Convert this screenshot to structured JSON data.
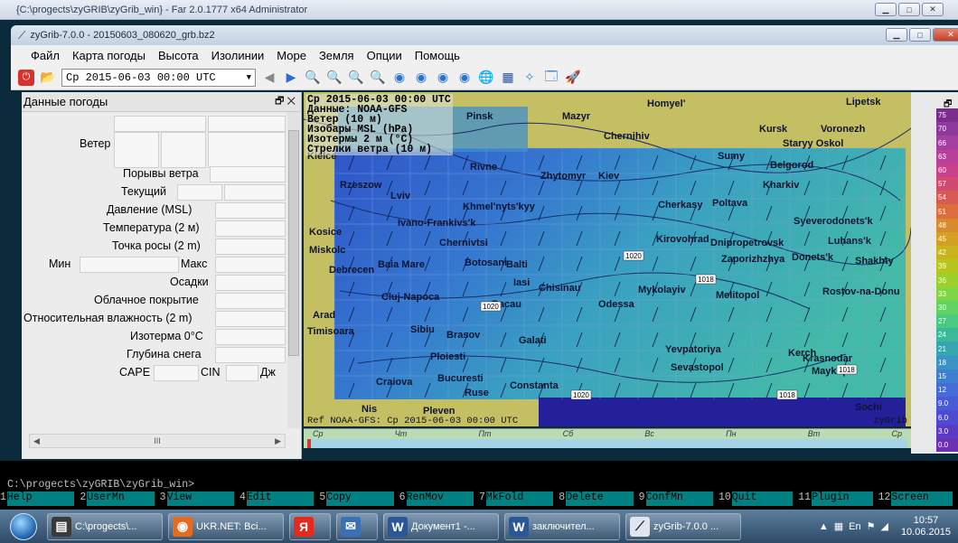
{
  "far_window": {
    "title": "{C:\\progects\\zyGRIB\\zyGrib_win} - Far 2.0.1777 x64 Administrator"
  },
  "app_window": {
    "title": "zyGrib-7.0.0 - 20150603_080620_grb.bz2"
  },
  "menu": [
    "Файл",
    "Карта погоды",
    "Высота",
    "Изолинии",
    "Море",
    "Земля",
    "Опции",
    "Помощь"
  ],
  "toolbar": {
    "date_value": "Ср 2015-06-03 00:00 UTC"
  },
  "panel": {
    "title": "Данные погоды",
    "labels": {
      "wind": "Ветер",
      "gusts": "Порывы ветра",
      "current": "Текущий",
      "pressure": "Давление (MSL)",
      "temperature": "Температура (2 м)",
      "dewpoint": "Точка росы (2 m)",
      "min": "Мин",
      "max": "Макс",
      "precip": "Осадки",
      "cloud": "Облачное покрытие",
      "humidity": "Относительная влажность (2 m)",
      "isotherm": "Изотерма 0°C",
      "snow": "Глубина снега",
      "cape": "CAPE",
      "cin": "CIN",
      "dj": "Дж"
    },
    "hscroll_mark": "III"
  },
  "map": {
    "info_lines": [
      "Ср 2015-06-03 00:00 UTC",
      "Данные: NOAA-GFS",
      "Ветер (10 м)",
      "Изобары MSL (hPa)",
      "Изотермы 2 м (°C)",
      "Стрелки ветра (10 м)"
    ],
    "footer_left": "Ref NOAA-GFS: Ср 2015-06-03 00:00 UTC",
    "footer_right": "zyGrib",
    "cities": [
      "Lipetsk",
      "Homyel'",
      "Pinsk",
      "Mazyr",
      "Kursk",
      "Voronezh",
      "Chernihiv",
      "Staryy Oskol",
      "Sumy",
      "Kielce",
      "Rivne",
      "Zhytomyr",
      "Kiev",
      "Belgorod",
      "Kharkiv",
      "Rzeszow",
      "Lviv",
      "Khmel'nyts'kyy",
      "Cherkasy",
      "Poltava",
      "Kosice",
      "Ivano-Frankivs'k",
      "Syeverodonets'k",
      "Chernivtsi",
      "Kirovohrad",
      "Dnipropetrovsk",
      "Luhans'k",
      "Miskolc",
      "Debrecen",
      "Baia Mare",
      "Botosani",
      "Balti",
      "Zaporizhzhya",
      "Donets'k",
      "Shakhty",
      "Iasi",
      "Chisinau",
      "Mykolayiv",
      "Cluj-Napoca",
      "Melitopol",
      "Rostov-na-Donu",
      "Bacau",
      "Odessa",
      "Arad",
      "Timisoara",
      "Sibiu",
      "Brasov",
      "Galati",
      "Yevpatoriya",
      "Kerch",
      "Krasnodar",
      "Ploiesti",
      "Sevastopol",
      "Maykop",
      "Craiova",
      "Bucuresti",
      "Constanta",
      "Ruse",
      "Sochi",
      "Pleven",
      "Nis"
    ],
    "pressure_labels": [
      "1020",
      "1020",
      "1020",
      "1018",
      "1018",
      "1018"
    ]
  },
  "timeline": {
    "days": [
      "Ср",
      "Чт",
      "Пт",
      "Сб",
      "Вс",
      "Пн",
      "Вт",
      "Ср"
    ]
  },
  "legend": {
    "values": [
      "75",
      "70",
      "66",
      "63",
      "60",
      "57",
      "54",
      "51",
      "48",
      "45",
      "42",
      "39",
      "36",
      "33",
      "30",
      "27",
      "24",
      "21",
      "18",
      "15",
      "12",
      "9.0",
      "6.0",
      "3.0",
      "0.0"
    ],
    "colors": [
      "#7b2d8b",
      "#8e3a9c",
      "#a33fa1",
      "#b8409a",
      "#c9418d",
      "#d24a72",
      "#d85a55",
      "#dc6e3e",
      "#d98a2c",
      "#d3a022",
      "#c9b41e",
      "#b8c51f",
      "#9ed02c",
      "#7fd644",
      "#5fd463",
      "#4ac980",
      "#3cb89b",
      "#34a6b0",
      "#3a93c2",
      "#3f7fd0",
      "#456cd8",
      "#4a5bd8",
      "#4f4ad2",
      "#5a3cc4",
      "#6a31b4"
    ]
  },
  "console": {
    "path": "C:\\progects\\zyGRIB\\zyGrib_win>",
    "fkeys": [
      {
        "n": "1",
        "t": "Help"
      },
      {
        "n": "2",
        "t": "UserMn"
      },
      {
        "n": "3",
        "t": "View"
      },
      {
        "n": "4",
        "t": "Edit"
      },
      {
        "n": "5",
        "t": "Copy"
      },
      {
        "n": "6",
        "t": "RenMov"
      },
      {
        "n": "7",
        "t": "MkFold"
      },
      {
        "n": "8",
        "t": "Delete"
      },
      {
        "n": "9",
        "t": "ConfMn"
      },
      {
        "n": "10",
        "t": "Quit"
      },
      {
        "n": "11",
        "t": "Plugin"
      },
      {
        "n": "12",
        "t": "Screen"
      }
    ]
  },
  "taskbar": {
    "items": [
      {
        "label": "C:\\progects\\...",
        "icon": "far-icon",
        "color": "#3a3a3a"
      },
      {
        "label": "UKR.NET: Всі...",
        "icon": "firefox-icon",
        "color": "#e66b1f"
      },
      {
        "label": "",
        "icon": "yandex-icon",
        "color": "#e42a1c"
      },
      {
        "label": "",
        "icon": "thunderbird-icon",
        "color": "#3b6fb6"
      },
      {
        "label": "Документ1 -...",
        "icon": "word-icon",
        "color": "#2b5797"
      },
      {
        "label": "заключител...",
        "icon": "word-icon",
        "color": "#2b5797"
      },
      {
        "label": "zyGrib-7.0.0 ...",
        "icon": "zygrib-icon",
        "color": "#dfe6ee"
      }
    ],
    "lang": "En",
    "time": "10:57",
    "date": "10.06.2015"
  }
}
